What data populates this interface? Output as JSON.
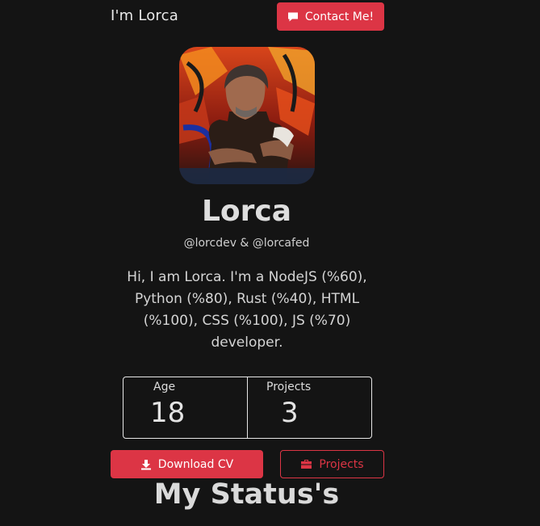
{
  "nav": {
    "brand": "I'm Lorca",
    "contact_label": "Contact Me!"
  },
  "profile": {
    "name": "Lorca",
    "handles": "@lorcdev & @lorcafed",
    "bio": "Hi, I am Lorca. I'm a NodeJS (%60), Python (%80), Rust (%40), HTML (%100), CSS (%100), JS (%70) developer."
  },
  "stats": [
    {
      "label": "Age",
      "value": "18"
    },
    {
      "label": "Projects",
      "value": "3"
    }
  ],
  "actions": {
    "download_cv_label": "Download CV",
    "projects_label": "Projects"
  },
  "section": {
    "title": "My Status's"
  },
  "icons": {
    "contact": "comment-icon",
    "download": "download-icon",
    "projects": "briefcase-icon"
  },
  "colors": {
    "accent": "#dc3545",
    "background": "#141414",
    "text": "#e6e6e6"
  }
}
